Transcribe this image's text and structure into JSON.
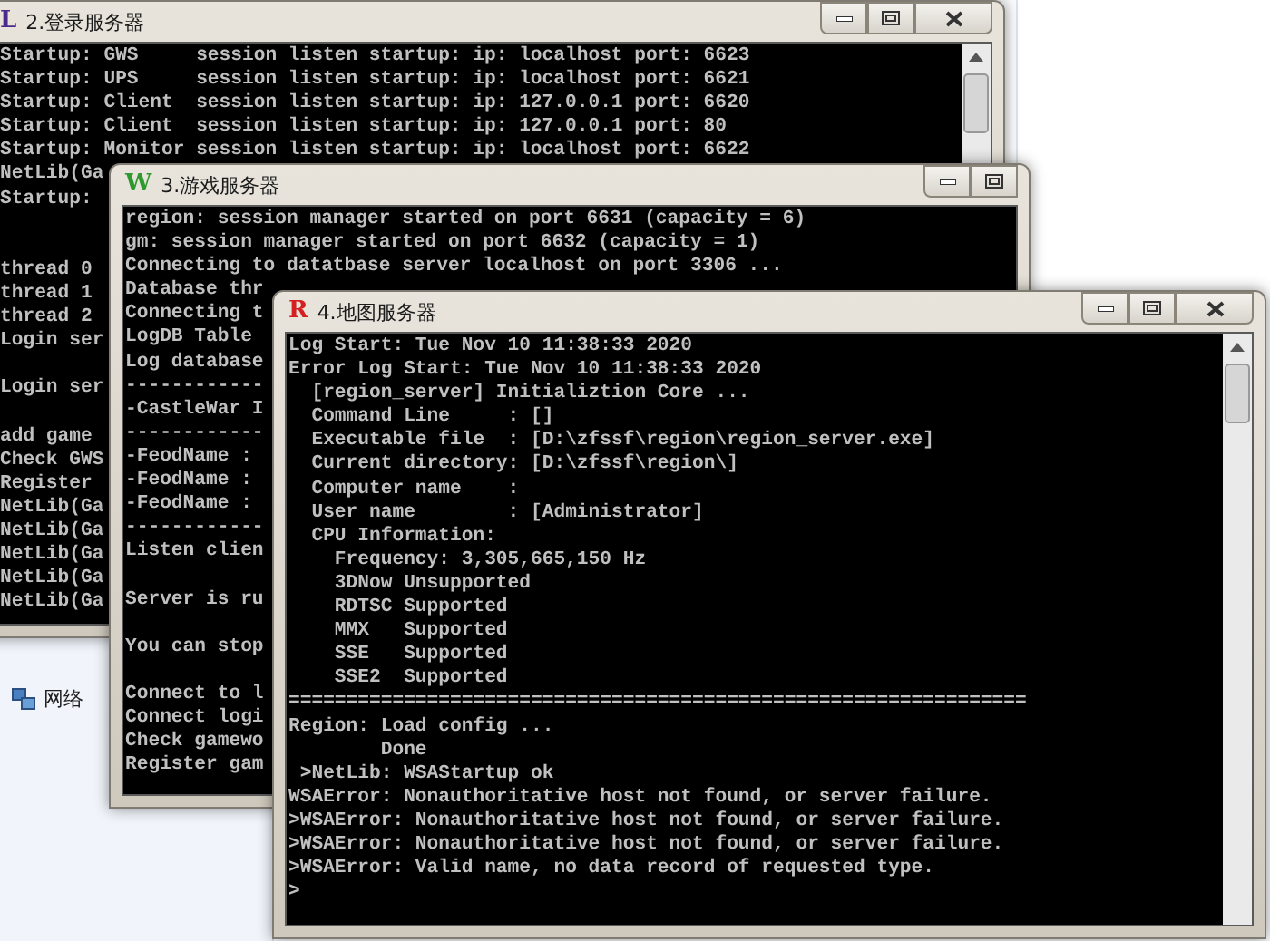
{
  "desktop": {
    "nav_item": "网络"
  },
  "windows": [
    {
      "title": "2.登录服务器",
      "icon_letter": "L",
      "color": "#4a2a8a",
      "buttons": [
        {
          "kind": "minimize"
        },
        {
          "kind": "maximize"
        },
        {
          "kind": "close"
        }
      ],
      "scrollbar": true,
      "lines": [
        {
          "text": "Startup: GWS     session listen startup: ip: localhost port: 6623",
          "kind": "line"
        },
        {
          "text": "Startup: UPS     session listen startup: ip: localhost port: 6621",
          "kind": "line"
        },
        {
          "text": "Startup: Client  session listen startup: ip: 127.0.0.1 port: 6620",
          "kind": "line"
        },
        {
          "text": "Startup: Client  session listen startup: ip: 127.0.0.1 port: 80",
          "kind": "line"
        },
        {
          "text": "Startup: Monitor session listen startup: ip: localhost port: 6622",
          "kind": "line"
        },
        {
          "text": "NetLib(Ga",
          "kind": "line"
        },
        {
          "text": "Startup:",
          "kind": "line"
        },
        {
          "text": "thread 0",
          "kind": "after_two_blanks"
        },
        {
          "text": "thread 1",
          "kind": "line"
        },
        {
          "text": "thread 2",
          "kind": "line"
        },
        {
          "text": "Login ser",
          "kind": "line"
        },
        {
          "text": "Login ser",
          "kind": "after_blank"
        },
        {
          "text": "add game",
          "kind": "after_blank"
        },
        {
          "text": "Check GWS",
          "kind": "line"
        },
        {
          "text": "Register",
          "kind": "line"
        },
        {
          "text": "NetLib(Ga",
          "kind": "line"
        },
        {
          "text": "NetLib(Ga",
          "kind": "line"
        },
        {
          "text": "NetLib(Ga",
          "kind": "line"
        },
        {
          "text": "NetLib(Ga",
          "kind": "line"
        },
        {
          "text": "NetLib(Ga",
          "kind": "line"
        }
      ]
    },
    {
      "title": "3.游戏服务器",
      "icon_letter": "W",
      "color": "#2e9a2e",
      "buttons": [
        {
          "kind": "minimize"
        },
        {
          "kind": "maximize"
        }
      ],
      "scrollbar": false,
      "lines": [
        {
          "text": "region: session manager started on port 6631 (capacity = 6)",
          "kind": "line"
        },
        {
          "text": "gm: session manager started on port 6632 (capacity = 1)",
          "kind": "line"
        },
        {
          "text": "Connecting to datatbase server localhost on port 3306 ...",
          "kind": "line"
        },
        {
          "text": "Database thr",
          "kind": "line"
        },
        {
          "text": "Connecting t",
          "kind": "line"
        },
        {
          "text": "LogDB Table",
          "kind": "line"
        },
        {
          "text": "Log database",
          "kind": "line"
        },
        {
          "text": "------------",
          "kind": "line"
        },
        {
          "text": "-CastleWar I",
          "kind": "line"
        },
        {
          "text": "------------",
          "kind": "line"
        },
        {
          "text": "-FeodName :",
          "kind": "line"
        },
        {
          "text": "-FeodName :",
          "kind": "line"
        },
        {
          "text": "-FeodName :",
          "kind": "line"
        },
        {
          "text": "------------",
          "kind": "line"
        },
        {
          "text": "Listen clien",
          "kind": "line"
        },
        {
          "text": "Server is ru",
          "kind": "after_blank"
        },
        {
          "text": "You can stop",
          "kind": "after_blank"
        },
        {
          "text": "Connect to l",
          "kind": "after_blank"
        },
        {
          "text": "Connect logi",
          "kind": "line"
        },
        {
          "text": "Check gamewo",
          "kind": "line"
        },
        {
          "text": "Register gam",
          "kind": "line"
        }
      ]
    },
    {
      "title": "4.地图服务器",
      "icon_letter": "R",
      "color": "#d42020",
      "buttons": [
        {
          "kind": "minimize"
        },
        {
          "kind": "maximize"
        },
        {
          "kind": "close"
        }
      ],
      "scrollbar": true,
      "lines": [
        {
          "text": "Log Start: Tue Nov 10 11:38:33 2020",
          "kind": "line"
        },
        {
          "text": "Error Log Start: Tue Nov 10 11:38:33 2020",
          "kind": "line"
        },
        {
          "text": "  [region_server] Initializtion Core ...",
          "kind": "line"
        },
        {
          "text": "  Command Line     : []",
          "kind": "line"
        },
        {
          "text": "  Executable file  : [D:\\zfssf\\region\\region_server.exe]",
          "kind": "line"
        },
        {
          "text": "  Current directory: [D:\\zfssf\\region\\]",
          "kind": "line"
        },
        {
          "text": "  Computer name    :",
          "kind": "line"
        },
        {
          "text": "  User name        : [Administrator]",
          "kind": "line"
        },
        {
          "text": "  CPU Information:",
          "kind": "line"
        },
        {
          "text": "    Frequency: 3,305,665,150 Hz",
          "kind": "line"
        },
        {
          "text": "    3DNow Unsupported",
          "kind": "line"
        },
        {
          "text": "    RDTSC Supported",
          "kind": "line"
        },
        {
          "text": "    MMX   Supported",
          "kind": "line"
        },
        {
          "text": "    SSE   Supported",
          "kind": "line"
        },
        {
          "text": "    SSE2  Supported",
          "kind": "line"
        },
        {
          "text": "================================================================",
          "kind": "line"
        },
        {
          "text": "Region: Load config ...",
          "kind": "line"
        },
        {
          "text": "        Done",
          "kind": "line"
        },
        {
          "text": " >NetLib: WSAStartup ok",
          "kind": "line"
        },
        {
          "text": "WSAError: Nonauthoritative host not found, or server failure.",
          "kind": "line"
        },
        {
          "text": ">WSAError: Nonauthoritative host not found, or server failure.",
          "kind": "line"
        },
        {
          "text": ">WSAError: Nonauthoritative host not found, or server failure.",
          "kind": "line"
        },
        {
          "text": ">WSAError: Valid name, no data record of requested type.",
          "kind": "line"
        },
        {
          "text": ">",
          "kind": "line"
        }
      ]
    }
  ]
}
